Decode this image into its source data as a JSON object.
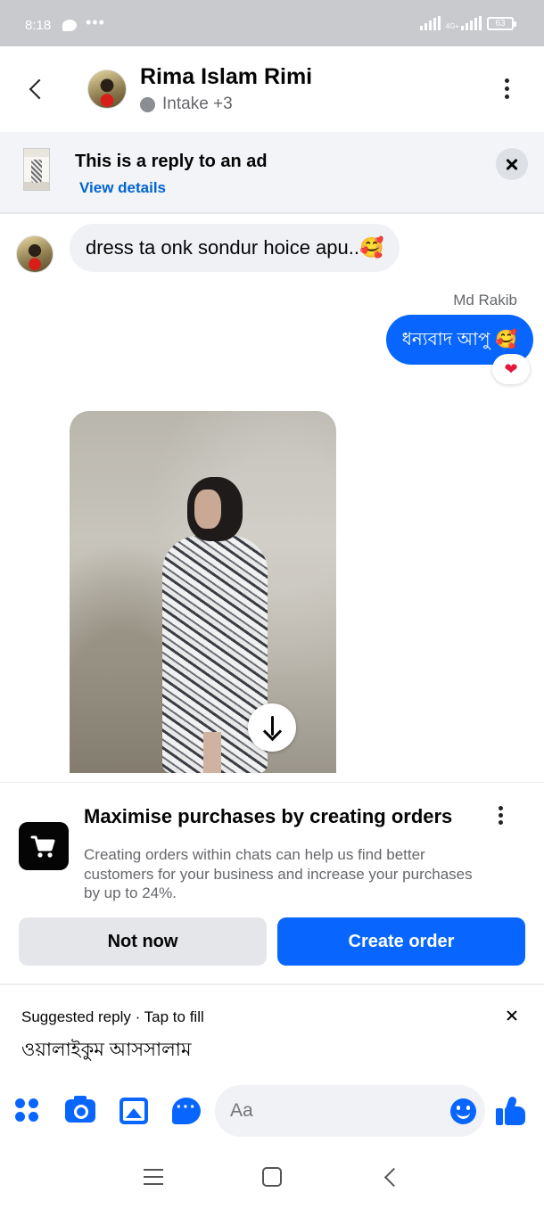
{
  "status_bar": {
    "time": "8:18",
    "network": "4G+",
    "battery": "63"
  },
  "header": {
    "contact_name": "Rima Islam Rimi",
    "subtitle": "Intake +3"
  },
  "ad_banner": {
    "title": "This is a reply to an ad",
    "link": "View details"
  },
  "messages": [
    {
      "direction": "incoming",
      "text": "dress ta onk sondur hoice apu..🥰"
    },
    {
      "direction": "outgoing",
      "sender": "Md Rakib",
      "text": "ধন্যবাদ আপু 🥰",
      "reaction": "❤"
    }
  ],
  "promo_card": {
    "title": "Maximise purchases by creating orders",
    "body": "Creating orders within chats can help us find better customers for your business and increase your purchases by up to 24%.",
    "secondary_button": "Not now",
    "primary_button": "Create order"
  },
  "suggested_reply": {
    "label": "Suggested reply · Tap to fill",
    "text": "ওয়ালাইকুম আসসালাম"
  },
  "composer": {
    "placeholder": "Aa"
  },
  "colors": {
    "accent": "#0866ff",
    "link": "#0064d1",
    "incoming_bubble": "#eff1f4",
    "secondary_text": "#65676b"
  }
}
